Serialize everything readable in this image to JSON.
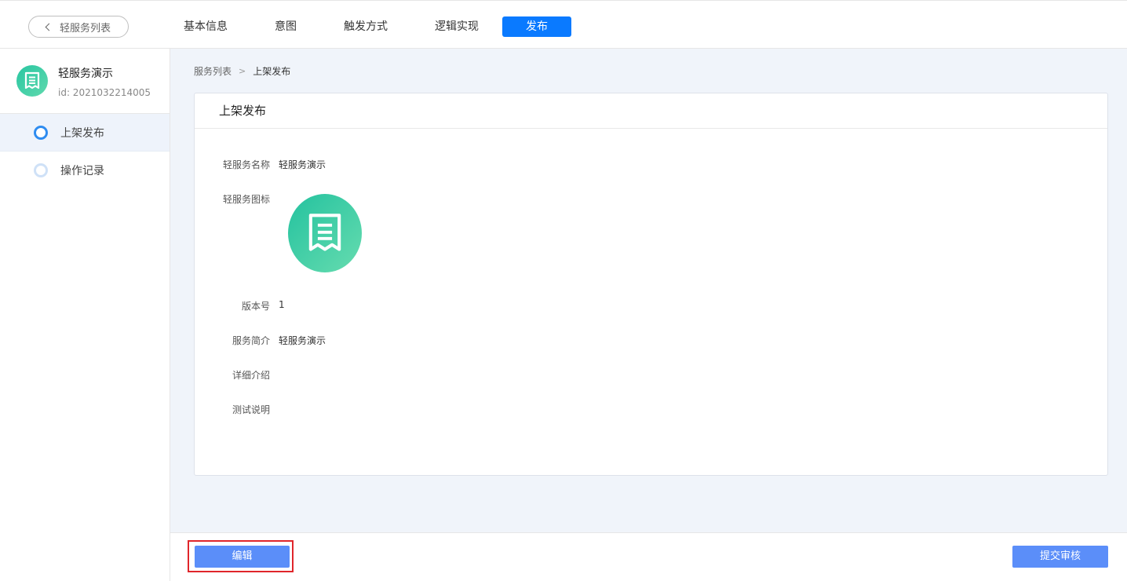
{
  "topbar": {
    "back_label": "轻服务列表",
    "tabs": [
      {
        "label": "基本信息"
      },
      {
        "label": "意图"
      },
      {
        "label": "触发方式"
      },
      {
        "label": "逻辑实现"
      },
      {
        "label": "发布"
      }
    ],
    "active_tab": "发布"
  },
  "sidebar": {
    "app_name": "轻服务演示",
    "app_id": "id: 2021032214005",
    "steps": [
      {
        "label": "上架发布"
      },
      {
        "label": "操作记录"
      }
    ]
  },
  "breadcrumb": {
    "parent": "服务列表",
    "separator": ">",
    "current": "上架发布"
  },
  "card": {
    "title": "上架发布",
    "fields": {
      "name": {
        "label": "轻服务名称",
        "value": "轻服务演示"
      },
      "icon": {
        "label": "轻服务图标"
      },
      "version": {
        "label": "版本号",
        "value": "1"
      },
      "summary": {
        "label": "服务简介",
        "value": "轻服务演示"
      },
      "detail": {
        "label": "详细介绍",
        "value": ""
      },
      "test_notes": {
        "label": "测试说明",
        "value": ""
      }
    }
  },
  "footer": {
    "edit_label": "编辑",
    "submit_label": "提交审核"
  },
  "colors": {
    "accent": "#0a7aff",
    "button": "#5b8ef9",
    "icon_gradient_start": "#24c29f",
    "icon_gradient_end": "#66dcaf",
    "highlight_border": "#e0262b"
  }
}
